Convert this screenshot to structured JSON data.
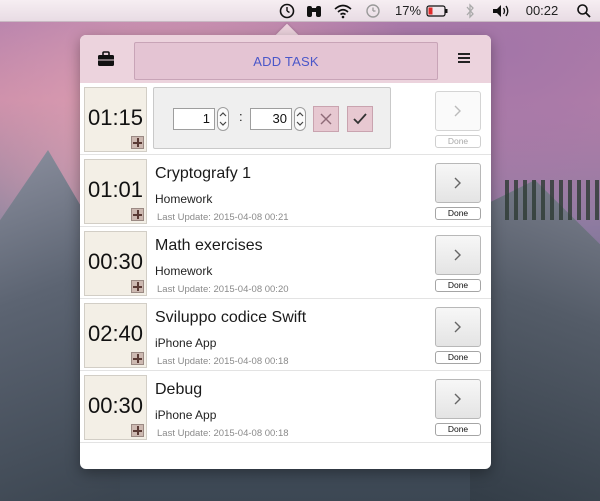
{
  "menubar": {
    "battery_percent": "17%",
    "clock": "00:22"
  },
  "header": {
    "add_task_label": "ADD TASK"
  },
  "edit": {
    "time": "01:15",
    "hours": "1",
    "minutes": "30",
    "separator": ":",
    "done_label": "Done"
  },
  "tasks": [
    {
      "time": "01:01",
      "title": "Cryptografy 1",
      "category": "Homework",
      "last_update": "Last Update: 2015-04-08 00:21",
      "done_label": "Done"
    },
    {
      "time": "00:30",
      "title": "Math exercises",
      "category": "Homework",
      "last_update": "Last Update: 2015-04-08 00:20",
      "done_label": "Done"
    },
    {
      "time": "02:40",
      "title": "Sviluppo codice Swift",
      "category": "iPhone App",
      "last_update": "Last Update: 2015-04-08 00:18",
      "done_label": "Done"
    },
    {
      "time": "00:30",
      "title": "Debug",
      "category": "iPhone App",
      "last_update": "Last Update: 2015-04-08 00:18",
      "done_label": "Done"
    }
  ],
  "colors": {
    "header_bg": "#ecd3dd",
    "add_task_text": "#4a57c9",
    "time_box_bg": "#f3efe6"
  },
  "icons": {
    "menubar": [
      "clock-icon",
      "binoculars-icon",
      "wifi-icon",
      "time-machine-icon",
      "battery-icon",
      "bluetooth-icon",
      "volume-icon",
      "spotlight-search-icon"
    ],
    "header": [
      "briefcase-icon",
      "hamburger-menu-icon"
    ]
  }
}
